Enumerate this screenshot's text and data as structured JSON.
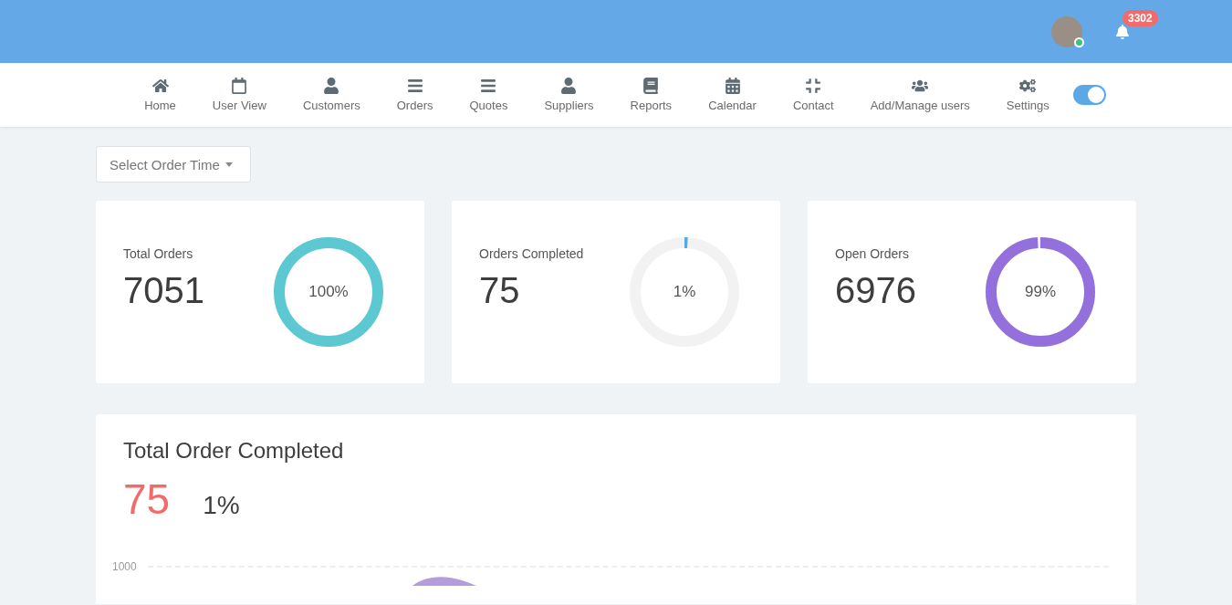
{
  "header": {
    "online": true,
    "notifications": "3302"
  },
  "nav": [
    {
      "label": "Home"
    },
    {
      "label": "User View"
    },
    {
      "label": "Customers"
    },
    {
      "label": "Orders"
    },
    {
      "label": "Quotes"
    },
    {
      "label": "Suppliers"
    },
    {
      "label": "Reports"
    },
    {
      "label": "Calendar"
    },
    {
      "label": "Contact"
    },
    {
      "label": "Add/Manage users"
    },
    {
      "label": "Settings"
    }
  ],
  "toggle": {
    "on": true
  },
  "filter": {
    "label": "Select Order Time"
  },
  "stats": [
    {
      "title": "Total Orders",
      "value": "7051",
      "percent": "100%",
      "level": 1,
      "color": "#5bc8d2"
    },
    {
      "title": "Orders Completed",
      "value": "75",
      "percent": "1%",
      "level": 0.01,
      "color": "#5aa9e6"
    },
    {
      "title": "Open Orders",
      "value": "6976",
      "percent": "99%",
      "level": 0.99,
      "color": "#9370db"
    }
  ],
  "summary": {
    "title": "Total Order Completed",
    "count": "75",
    "percent": "1%",
    "y_tick": "1000"
  }
}
